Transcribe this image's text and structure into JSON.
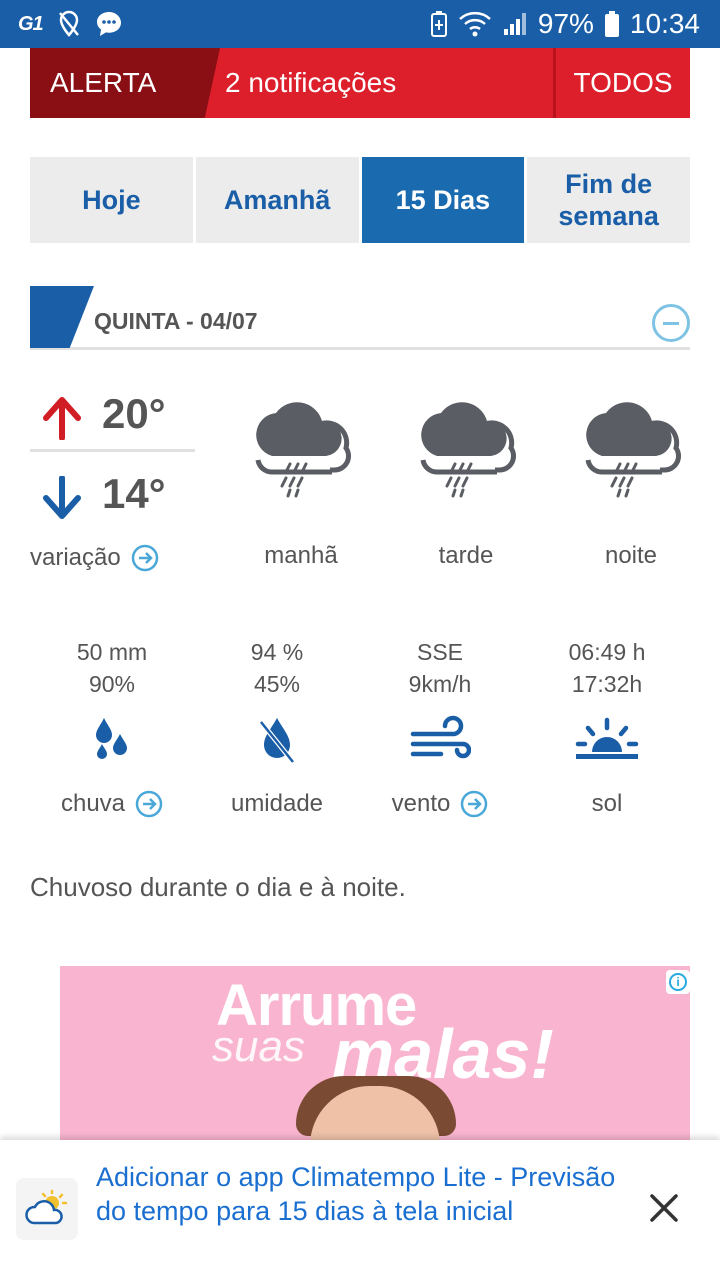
{
  "status_bar": {
    "left_icons": [
      "g1-icon",
      "location-off-icon",
      "chat-icon"
    ],
    "g1_text": "G1",
    "battery": "97%",
    "time": "10:34"
  },
  "alert": {
    "tag": "ALERTA",
    "text": "2 notificações",
    "all_label": "TODOS"
  },
  "tabs": [
    {
      "label": "Hoje",
      "active": false
    },
    {
      "label": "Amanhã",
      "active": false
    },
    {
      "label": "15 Dias",
      "active": true
    },
    {
      "label": "Fim de semana",
      "active": false
    }
  ],
  "day": {
    "title": "QUINTA - 04/07",
    "temp_max": "20°",
    "temp_min": "14°",
    "variation_label": "variação",
    "periods": [
      {
        "label": "manhã",
        "icon": "rain-cloud-icon"
      },
      {
        "label": "tarde",
        "icon": "rain-cloud-icon"
      },
      {
        "label": "noite",
        "icon": "rain-cloud-icon"
      }
    ],
    "stats": {
      "rain": {
        "line1": "50 mm",
        "line2": "90%",
        "label": "chuva",
        "icon": "rain-drops-icon"
      },
      "humidity": {
        "line1": "94 %",
        "line2": "45%",
        "label": "umidade",
        "icon": "humidity-icon"
      },
      "wind": {
        "line1": "SSE",
        "line2": "9km/h",
        "label": "vento",
        "icon": "wind-icon"
      },
      "sun": {
        "line1": "06:49 h",
        "line2": "17:32h",
        "label": "sol",
        "icon": "sunrise-icon"
      }
    },
    "summary": "Chuvoso durante o dia e à noite."
  },
  "ad": {
    "line1": "Arrume",
    "line2a": "suas",
    "line2b": "malas!",
    "info": "i"
  },
  "install_banner": {
    "text": "Adicionar o app Climatempo Lite - Previsão do tempo para 15 dias à tela inicial"
  },
  "colors": {
    "brand_blue": "#1a5ea8",
    "alert_red": "#dc1f2b",
    "alert_dark_red": "#8a0f15",
    "max_arrow": "#d11e25",
    "min_arrow": "#1a5ea8",
    "link_blue": "#1a6fd0"
  }
}
